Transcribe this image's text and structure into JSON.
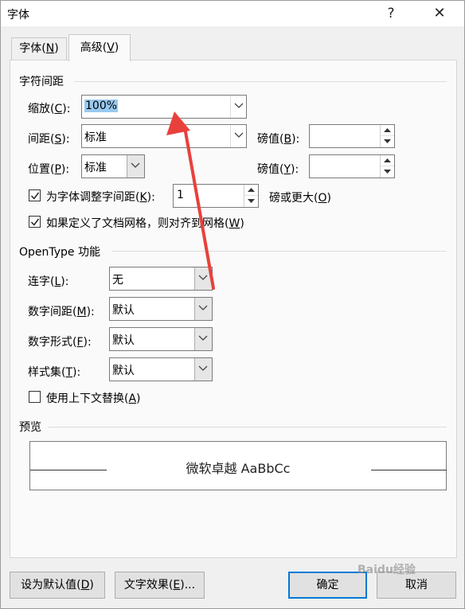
{
  "window": {
    "title": "字体",
    "help_icon": "?",
    "close_icon": "✕"
  },
  "tabs": {
    "font": "字体(",
    "font_key": "N",
    "font_end": ")",
    "advanced": "高级(",
    "advanced_key": "V",
    "advanced_end": ")"
  },
  "char_spacing": {
    "title": "字符间距",
    "scale_label": "缩放(",
    "scale_key": "C",
    "scale_end": "):",
    "scale_value": "100%",
    "spacing_label": "间距(",
    "spacing_key": "S",
    "spacing_end": "):",
    "spacing_value": "标准",
    "spacing_pt_label": "磅值(",
    "spacing_pt_key": "B",
    "spacing_pt_end": "):",
    "spacing_pt_value": "",
    "position_label": "位置(",
    "position_key": "P",
    "position_end": "):",
    "position_value": "标准",
    "position_pt_label": "磅值(",
    "position_pt_key": "Y",
    "position_pt_end": "):",
    "position_pt_value": "",
    "kerning_checked": true,
    "kerning_label": "为字体调整字间距(",
    "kerning_key": "K",
    "kerning_end": "):",
    "kerning_value": "1",
    "kerning_suffix": "磅或更大(",
    "kerning_suffix_key": "O",
    "kerning_suffix_end": ")",
    "grid_checked": true,
    "grid_label": "如果定义了文档网格，则对齐到网格(",
    "grid_key": "W",
    "grid_end": ")"
  },
  "opentype": {
    "title": "OpenType 功能",
    "ligatures_label": "连字(",
    "ligatures_key": "L",
    "ligatures_end": "):",
    "ligatures_value": "无",
    "numspacing_label": "数字间距(",
    "numspacing_key": "M",
    "numspacing_end": "):",
    "numspacing_value": "默认",
    "numforms_label": "数字形式(",
    "numforms_key": "F",
    "numforms_end": "):",
    "numforms_value": "默认",
    "stylesets_label": "样式集(",
    "stylesets_key": "T",
    "stylesets_end": "):",
    "stylesets_value": "默认",
    "contextual_checked": false,
    "contextual_label": "使用上下文替换(",
    "contextual_key": "A",
    "contextual_end": ")"
  },
  "preview": {
    "title": "预览",
    "text": "微软卓越  AaBbCc"
  },
  "buttons": {
    "default_label": "设为默认值(",
    "default_key": "D",
    "default_end": ")",
    "effects_label": "文字效果(",
    "effects_key": "E",
    "effects_end": ")...",
    "ok": "确定",
    "cancel": "取消"
  },
  "annotation": {
    "color": "#e8413c"
  },
  "watermark": "Baidu经验"
}
